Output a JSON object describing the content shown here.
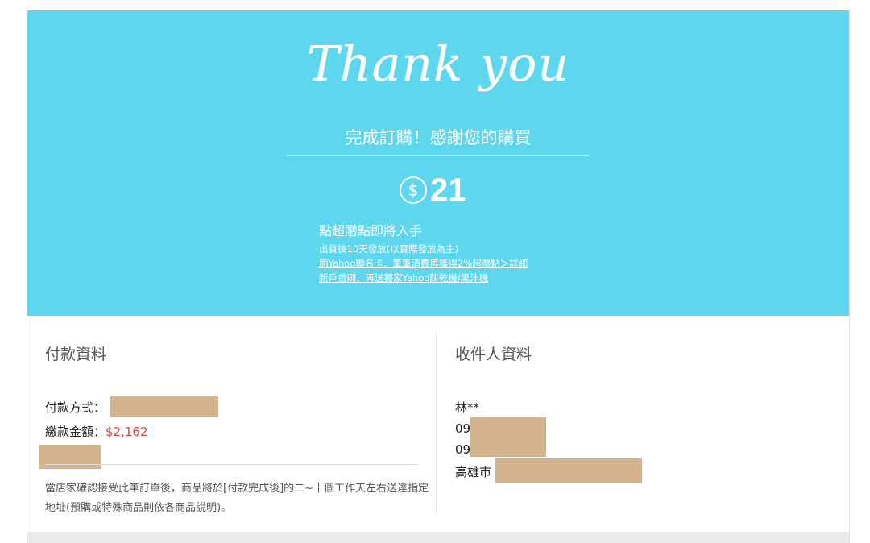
{
  "hero": {
    "script_title": "Thank you",
    "headline": "完成訂購！感謝您的購買",
    "points_value": "21",
    "points_currency_symbol": "$",
    "points_title": "點超贈點即將入手",
    "points_note": "出貨後10天發放(以實際發放為主)",
    "link_card": "刷Yahoo聯名卡．筆筆消費再獲得2%超贈點＞詳細",
    "link_new": "新戶首刷．再送獨家Yahoo餅乾機/果汁機",
    "background_color": "#5ed6ee"
  },
  "payment": {
    "title": "付款資料",
    "method_label": "付款方式：",
    "amount_label": "繳款金額：",
    "amount_value": "$2,162",
    "note": "當店家確認接受此筆訂單後，商品將於[付款完成後]的二~十個工作天左右送達指定地址(預購或特殊商品則依各商品說明)。"
  },
  "recipient": {
    "title": "收件人資料",
    "name": "林**",
    "phone_prefix_1": "09",
    "phone_prefix_2": "09",
    "address_prefix": "高雄市"
  },
  "colors": {
    "redaction": "#d4b48e",
    "amount_red": "#e04040"
  }
}
